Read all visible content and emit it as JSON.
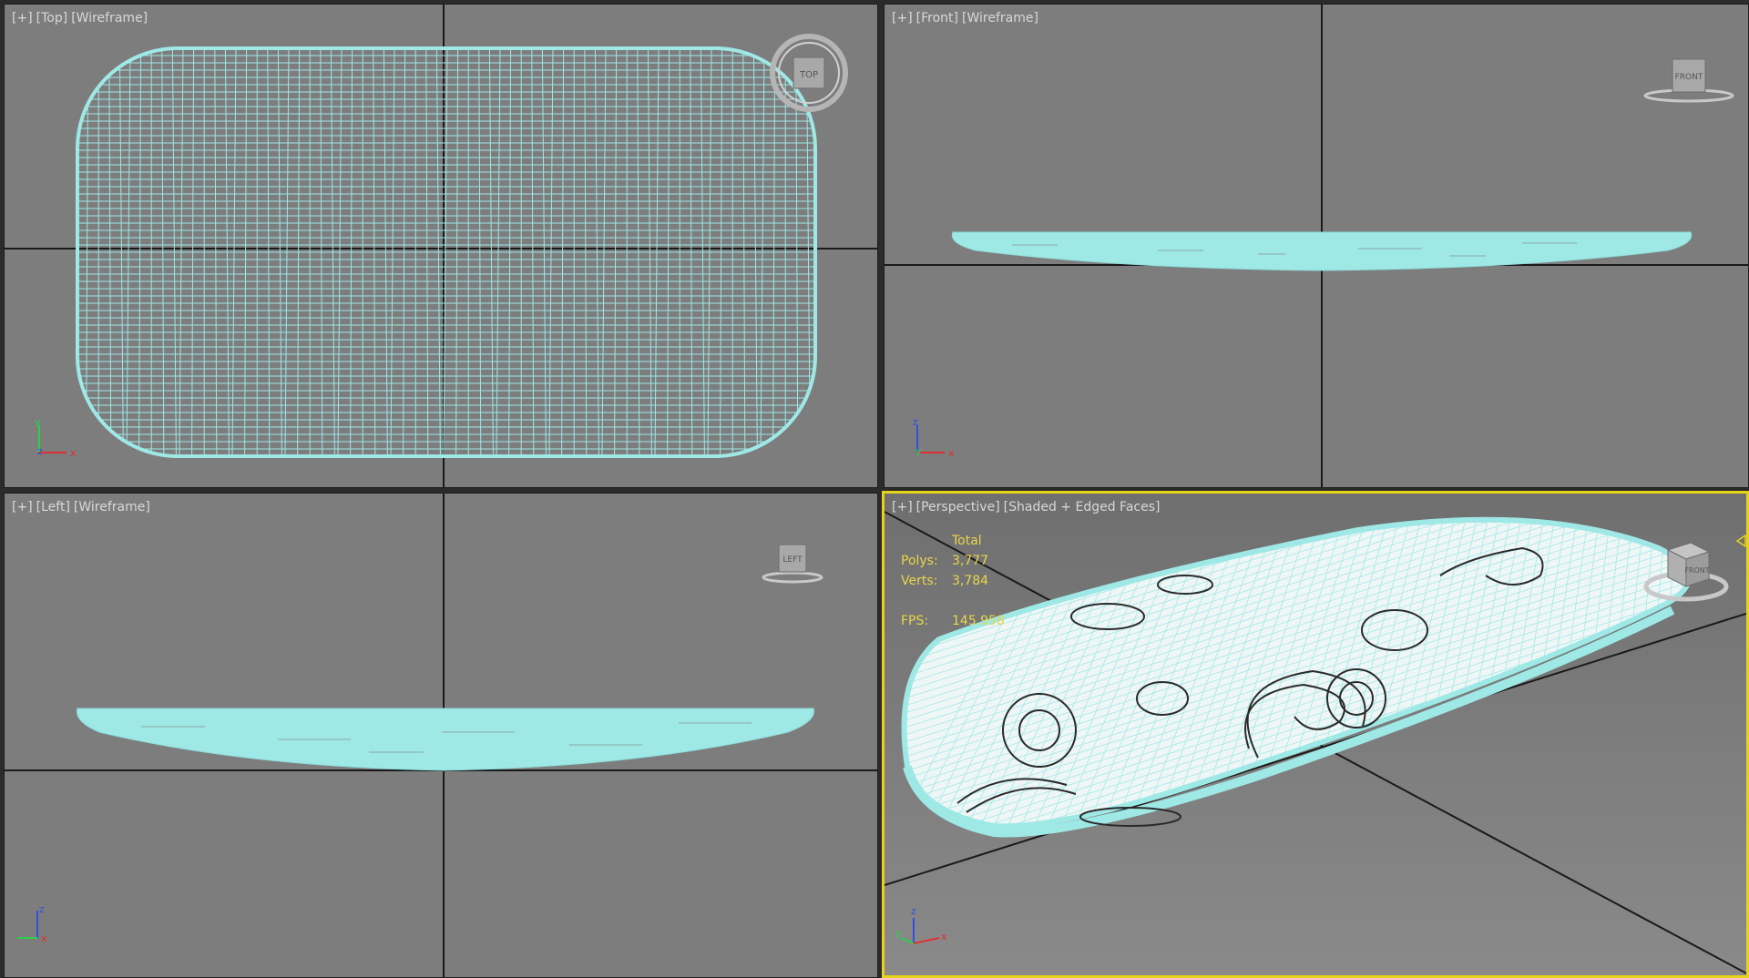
{
  "viewports": {
    "top": {
      "plus": "[+]",
      "view": "[Top]",
      "mode": "[Wireframe]",
      "cube": "TOP"
    },
    "front": {
      "plus": "[+]",
      "view": "[Front]",
      "mode": "[Wireframe]",
      "cube": "FRONT"
    },
    "left": {
      "plus": "[+]",
      "view": "[Left]",
      "mode": "[Wireframe]",
      "cube": "LEFT"
    },
    "perspective": {
      "plus": "[+]",
      "view": "[Perspective]",
      "mode": "[Shaded + Edged Faces]",
      "cube": "FRONT"
    }
  },
  "stats": {
    "header": "Total",
    "polys_label": "Polys:",
    "polys_value": "3,777",
    "verts_label": "Verts:",
    "verts_value": "3,784",
    "fps_label": "FPS:",
    "fps_value": "145.958"
  },
  "axes": {
    "top": [
      "y",
      "z",
      "x"
    ],
    "front": [
      "z",
      "y",
      "x"
    ],
    "left": [
      "z",
      "x"
    ],
    "persp": [
      "z",
      "y",
      "x"
    ]
  },
  "colors": {
    "viewport_bg": "#7d7d7d",
    "wire": "#9ee8e6",
    "active_border": "#e6d21a",
    "stats": "#e8d64a"
  }
}
